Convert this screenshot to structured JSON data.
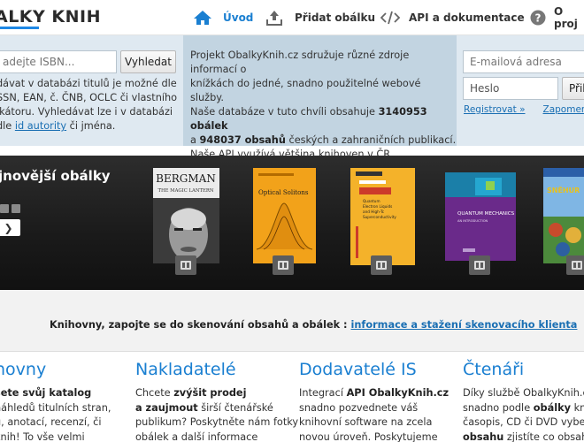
{
  "colors": {
    "accent": "#1a7fd1",
    "link": "#1a6fb3",
    "strip": "#dfe9f1",
    "strip_mid": "#c2d4e1",
    "carousel_bg": "#1e1e1e"
  },
  "header": {
    "logo": "ALKY KNIH",
    "nav": [
      {
        "label": "Úvod",
        "icon": "home-icon",
        "active": true
      },
      {
        "label": "Přidat obálku",
        "icon": "upload-icon"
      },
      {
        "label": "API a dokumentace",
        "icon": "code-icon"
      },
      {
        "label": "O proj",
        "icon": "help-icon"
      }
    ]
  },
  "search": {
    "placeholder": "adejte ISBN...",
    "button": "Vyhledat",
    "help": {
      "l1": "dávat v databázi titulů je možné dle",
      "l2": "SSN, EAN, č. ČNB, OCLC či vlastního",
      "l3": "ikátoru. Vyhledávat lze i v databázi",
      "l4_pre": " dle ",
      "l4_link": "id autority",
      "l4_post": " či jména."
    }
  },
  "intro": {
    "l1": "Projekt ObalkyKnih.cz sdružuje různé zdroje informací o",
    "l2": "knížkách do jedné, snadno použitelné webové služby.",
    "l3_pre": "Naše databáze v tuto chvíli obsahuje ",
    "covers_count": "3140953 obálek",
    "l4_pre": "a ",
    "toc_count": "948037 obsahů",
    "l4_post": " českých a zahraničních publikací.",
    "l5": "Naše API využívá většina knihoven v ČR."
  },
  "login": {
    "email_placeholder": "E-mailová adresa",
    "password_value": "Heslo",
    "submit": "Přih",
    "register": "Registrovat »",
    "forgot": "Zapomenuté h"
  },
  "carousel": {
    "title": "jnovější obálky",
    "prev": "❯",
    "covers": [
      {
        "title": "BERGMAN",
        "subtitle": "THE MAGIC LANTERN",
        "icon": "cover-image"
      },
      {
        "title": "Optical Solitons",
        "icon": "cover-image"
      },
      {
        "title": "Quantum Electron Liquids and High-Tc Superconductivity",
        "icon": "cover-image"
      },
      {
        "title": "QUANTUM MECHANICS",
        "subtitle": "AN INTRODUCTION",
        "icon": "cover-image"
      },
      {
        "title": "SNĚHUR",
        "icon": "cover-image"
      }
    ]
  },
  "scan": {
    "text": "Knihovny, zapojte se do skenování obsahů a obálek : ",
    "link": "informace a stažení skenovacího klienta"
  },
  "columns": [
    {
      "title": "hovny",
      "lines": [
        {
          "b": "šete svůj katalog",
          "t": ""
        },
        {
          "b": "",
          "t": "náhledů titulních stran,"
        },
        {
          "b": "",
          "t": "ů, anotací, recenzí, či"
        },
        {
          "b": "",
          "t": "knih! To vše velmi"
        }
      ]
    },
    {
      "title": "Nakladatelé",
      "lines": [
        {
          "t": "Chcete ",
          "b": "zvýšit prodej"
        },
        {
          "t": "",
          "b": "a zaujmout",
          "t2": " širší čtenářské"
        },
        {
          "t": "publikum? Poskytněte nám fotky",
          "b": ""
        },
        {
          "t": "obálek a další informace",
          "b": ""
        }
      ]
    },
    {
      "title": "Dodavatelé IS",
      "lines": [
        {
          "t": "Integrací ",
          "b": "API ObalkyKnih.cz"
        },
        {
          "t": "snadno pozvednete váš",
          "b": ""
        },
        {
          "t": "knihovní software na zcela",
          "b": ""
        },
        {
          "t": "novou úroveň. Poskytujeme",
          "b": ""
        }
      ]
    },
    {
      "title": "Čtenáři",
      "lines": [
        {
          "t": "Díky službě ObalkyKnih.cz",
          "b": ""
        },
        {
          "t": "snadno podle ",
          "b": "obálky",
          "t2": " knih"
        },
        {
          "t": "časopis, CD či DVD vyber",
          "b": ""
        },
        {
          "t": "",
          "b": "obsahu",
          "t2": " zjistíte co obsahu"
        }
      ]
    }
  ]
}
